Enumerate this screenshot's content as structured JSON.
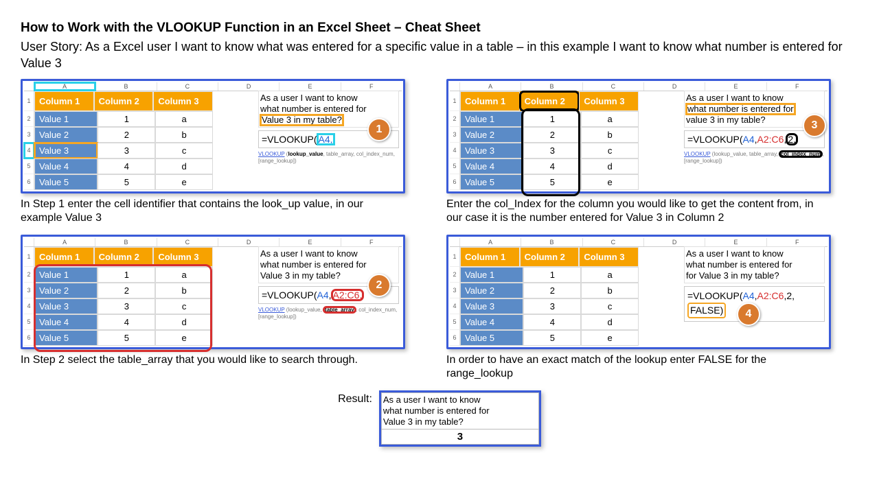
{
  "title": "How to Work with the VLOOKUP Function in an Excel Sheet – Cheat Sheet",
  "user_story": "User Story: As a Excel user I want to know what was entered for a specific value in a table – in this example I want to know what number is entered for Value 3",
  "columns": [
    "A",
    "B",
    "C",
    "D",
    "E",
    "F"
  ],
  "headers": {
    "c1": "Column 1",
    "c2": "Column 2",
    "c3": "Column 3"
  },
  "rows": [
    {
      "v": "Value 1",
      "n": "1",
      "l": "a"
    },
    {
      "v": "Value 2",
      "n": "2",
      "l": "b"
    },
    {
      "v": "Value 3",
      "n": "3",
      "l": "c"
    },
    {
      "v": "Value 4",
      "n": "4",
      "l": "d"
    },
    {
      "v": "Value 5",
      "n": "5",
      "l": "e"
    }
  ],
  "note_lines": {
    "l1": "As a user I want to know",
    "l2": "what number is entered for",
    "l3": "Value 3 in my table?",
    "l3v2": "for Value 3 in my table?",
    "l3v3": "value 3 in my table?"
  },
  "hint": {
    "fn": "VLOOKUP",
    "args": "(lookup_value, table_array, col_index_num, [range_lookup])",
    "arg_lookup": "lookup_value",
    "arg_table": "table_array",
    "arg_col": "col_index_num",
    "arg_range": "[range_lookup]"
  },
  "step1": {
    "formula_pre": "=VLOOKUP(",
    "a4": "A4,",
    "caption": "In Step 1 enter the cell identifier that contains the look_up value, in our example Value 3",
    "badge": "1"
  },
  "step2": {
    "formula_pre": "=VLOOKUP(",
    "a4": "A4",
    "comma": ",",
    "range": "A2:C6,",
    "caption": "In Step 2 select the table_array that you would like to search through.",
    "badge": "2"
  },
  "step3": {
    "formula_pre": "=VLOOKUP(",
    "a4": "A4",
    "c1": ",",
    "range": "A2:C6",
    "c2": ",",
    "idx": "2,",
    "caption": "Enter the col_Index for the column you would like to get the content from, in our case it is the number entered for Value 3 in Column 2",
    "badge": "3"
  },
  "step4": {
    "formula_line1_pre": "=VLOOKUP(",
    "a4": "A4",
    "c1": ",",
    "range": "A2:C6",
    "c2": ",",
    "idx": "2",
    "c3": ",",
    "formula_line2": "FALSE)",
    "caption": "In order to have an exact match of the lookup enter FALSE for the range_lookup",
    "badge": "4"
  },
  "result": {
    "label": "Result:",
    "answer": "3"
  }
}
